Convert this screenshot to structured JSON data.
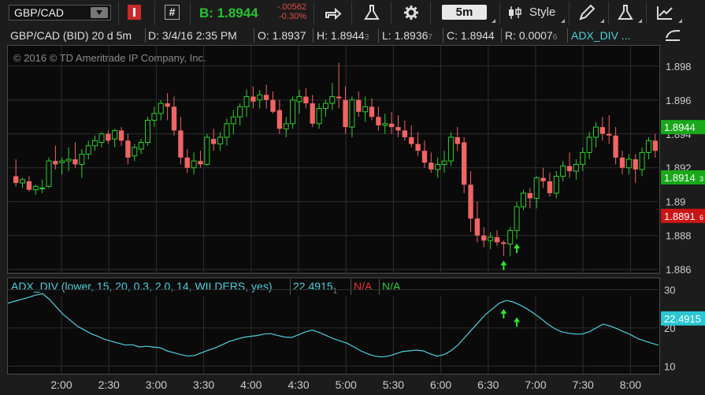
{
  "toolbar": {
    "symbol": "GBP/CAD",
    "bid_label": "B: 1.8944",
    "change_abs": "-.00562",
    "change_pct": "-0.30%",
    "timeframe": "5m",
    "style_label": "Style"
  },
  "infobar": {
    "instrument": "GBP/CAD (BID) 20 d 5m",
    "date": "D: 3/4/16 2:35 PM",
    "open": "O: 1.8937",
    "high": "H: 1.8944",
    "high_sub": "3",
    "low": "L: 1.8936",
    "low_sub": "7",
    "close": "C: 1.8944",
    "range": "R: 0.0007",
    "range_sub": "6",
    "study": "ADX_DIV ..."
  },
  "copyright": "© 2016 © TD Ameritrade IP Company, Inc.",
  "price_axis": {
    "ticks": [
      "1.898",
      "1.896",
      "1.894",
      "1.892",
      "1.89",
      "1.888",
      "1.886"
    ],
    "last_price_badge": "1.8944",
    "level_badge_green": "1.8914",
    "level_badge_green_sub": "3",
    "level_badge_red": "1.8891",
    "level_badge_red_sub": "6",
    "colors": {
      "up": "#2ecf2e",
      "down": "#f26464",
      "green_badge": "#19a819",
      "red_badge": "#cc1414"
    }
  },
  "lower_study": {
    "label": "ADX_DIV (lower, 15, 20, 0.3, 2.0, 14, WILDERS, yes)",
    "value": "22.4915",
    "value_sub": "1",
    "na_red": "N/A",
    "na_green": "N/A",
    "ticks": [
      "30",
      "20",
      "10"
    ],
    "badge": "22.4915",
    "line_color": "#4fd0dc"
  },
  "time_axis": [
    "2:00",
    "2:30",
    "3:00",
    "3:30",
    "4:00",
    "4:30",
    "5:00",
    "5:30",
    "6:00",
    "6:30",
    "7:00",
    "7:30",
    "8:00"
  ],
  "chart_data": {
    "type": "candlestick",
    "title": "GBP/CAD (BID) 20 d 5m",
    "ylim": [
      1.8858,
      1.8992
    ],
    "x_labels": [
      "2:00",
      "2:30",
      "3:00",
      "3:30",
      "4:00",
      "4:30",
      "5:00",
      "5:30",
      "6:00",
      "6:30",
      "7:00",
      "7:30",
      "8:00"
    ],
    "candles": [
      {
        "o": 1.8915,
        "h": 1.8925,
        "l": 1.8909,
        "c": 1.8911
      },
      {
        "o": 1.8911,
        "h": 1.8914,
        "l": 1.8908,
        "c": 1.8913
      },
      {
        "o": 1.8912,
        "h": 1.8915,
        "l": 1.8906,
        "c": 1.8907
      },
      {
        "o": 1.8907,
        "h": 1.891,
        "l": 1.8904,
        "c": 1.8909
      },
      {
        "o": 1.8908,
        "h": 1.8913,
        "l": 1.8905,
        "c": 1.8908
      },
      {
        "o": 1.8909,
        "h": 1.8926,
        "l": 1.8908,
        "c": 1.8924
      },
      {
        "o": 1.8924,
        "h": 1.8933,
        "l": 1.8919,
        "c": 1.8922
      },
      {
        "o": 1.8923,
        "h": 1.8926,
        "l": 1.8916,
        "c": 1.8924
      },
      {
        "o": 1.8924,
        "h": 1.8932,
        "l": 1.8918,
        "c": 1.8925
      },
      {
        "o": 1.8925,
        "h": 1.8935,
        "l": 1.892,
        "c": 1.8922
      },
      {
        "o": 1.8922,
        "h": 1.8931,
        "l": 1.8914,
        "c": 1.8928
      },
      {
        "o": 1.8928,
        "h": 1.8936,
        "l": 1.8925,
        "c": 1.8933
      },
      {
        "o": 1.8933,
        "h": 1.8939,
        "l": 1.893,
        "c": 1.8936
      },
      {
        "o": 1.8935,
        "h": 1.8941,
        "l": 1.8932,
        "c": 1.894
      },
      {
        "o": 1.894,
        "h": 1.8942,
        "l": 1.8934,
        "c": 1.8936
      },
      {
        "o": 1.8937,
        "h": 1.8943,
        "l": 1.8932,
        "c": 1.8942
      },
      {
        "o": 1.8942,
        "h": 1.8944,
        "l": 1.8933,
        "c": 1.8936
      },
      {
        "o": 1.8936,
        "h": 1.894,
        "l": 1.8922,
        "c": 1.8926
      },
      {
        "o": 1.8927,
        "h": 1.8934,
        "l": 1.8924,
        "c": 1.8932
      },
      {
        "o": 1.8931,
        "h": 1.8937,
        "l": 1.8928,
        "c": 1.8935
      },
      {
        "o": 1.8935,
        "h": 1.895,
        "l": 1.8933,
        "c": 1.8948
      },
      {
        "o": 1.8948,
        "h": 1.8956,
        "l": 1.8944,
        "c": 1.8952
      },
      {
        "o": 1.8952,
        "h": 1.896,
        "l": 1.8948,
        "c": 1.8958
      },
      {
        "o": 1.8958,
        "h": 1.8964,
        "l": 1.8948,
        "c": 1.8956
      },
      {
        "o": 1.8956,
        "h": 1.8962,
        "l": 1.8939,
        "c": 1.8942
      },
      {
        "o": 1.8942,
        "h": 1.895,
        "l": 1.8922,
        "c": 1.8926
      },
      {
        "o": 1.8926,
        "h": 1.8931,
        "l": 1.8917,
        "c": 1.892
      },
      {
        "o": 1.892,
        "h": 1.8929,
        "l": 1.8916,
        "c": 1.8924
      },
      {
        "o": 1.8924,
        "h": 1.893,
        "l": 1.892,
        "c": 1.8922
      },
      {
        "o": 1.8922,
        "h": 1.894,
        "l": 1.8921,
        "c": 1.8938
      },
      {
        "o": 1.8937,
        "h": 1.8943,
        "l": 1.893,
        "c": 1.8934
      },
      {
        "o": 1.8934,
        "h": 1.8941,
        "l": 1.893,
        "c": 1.8938
      },
      {
        "o": 1.8938,
        "h": 1.8949,
        "l": 1.8933,
        "c": 1.8946
      },
      {
        "o": 1.8946,
        "h": 1.8954,
        "l": 1.894,
        "c": 1.895
      },
      {
        "o": 1.895,
        "h": 1.8958,
        "l": 1.8945,
        "c": 1.8956
      },
      {
        "o": 1.8956,
        "h": 1.8966,
        "l": 1.895,
        "c": 1.8962
      },
      {
        "o": 1.8962,
        "h": 1.8968,
        "l": 1.8955,
        "c": 1.8959
      },
      {
        "o": 1.896,
        "h": 1.8966,
        "l": 1.8955,
        "c": 1.8963
      },
      {
        "o": 1.8963,
        "h": 1.8969,
        "l": 1.8955,
        "c": 1.896
      },
      {
        "o": 1.896,
        "h": 1.8965,
        "l": 1.8952,
        "c": 1.8953
      },
      {
        "o": 1.8954,
        "h": 1.896,
        "l": 1.894,
        "c": 1.8943
      },
      {
        "o": 1.8943,
        "h": 1.895,
        "l": 1.8938,
        "c": 1.8946
      },
      {
        "o": 1.8946,
        "h": 1.8962,
        "l": 1.8943,
        "c": 1.896
      },
      {
        "o": 1.8959,
        "h": 1.8966,
        "l": 1.8952,
        "c": 1.8962
      },
      {
        "o": 1.8962,
        "h": 1.8967,
        "l": 1.8955,
        "c": 1.8958
      },
      {
        "o": 1.8958,
        "h": 1.8963,
        "l": 1.8944,
        "c": 1.8946
      },
      {
        "o": 1.8946,
        "h": 1.8958,
        "l": 1.8943,
        "c": 1.8955
      },
      {
        "o": 1.8955,
        "h": 1.896,
        "l": 1.895,
        "c": 1.8958
      },
      {
        "o": 1.8958,
        "h": 1.897,
        "l": 1.8954,
        "c": 1.8962
      },
      {
        "o": 1.8962,
        "h": 1.8982,
        "l": 1.8955,
        "c": 1.8961
      },
      {
        "o": 1.896,
        "h": 1.8968,
        "l": 1.894,
        "c": 1.8944
      },
      {
        "o": 1.8944,
        "h": 1.8962,
        "l": 1.8938,
        "c": 1.896
      },
      {
        "o": 1.896,
        "h": 1.8965,
        "l": 1.895,
        "c": 1.8953
      },
      {
        "o": 1.8953,
        "h": 1.8962,
        "l": 1.8947,
        "c": 1.8956
      },
      {
        "o": 1.8956,
        "h": 1.8961,
        "l": 1.8948,
        "c": 1.895
      },
      {
        "o": 1.895,
        "h": 1.8956,
        "l": 1.8942,
        "c": 1.8945
      },
      {
        "o": 1.8945,
        "h": 1.8952,
        "l": 1.894,
        "c": 1.8946
      },
      {
        "o": 1.8946,
        "h": 1.8953,
        "l": 1.894,
        "c": 1.8944
      },
      {
        "o": 1.8944,
        "h": 1.8951,
        "l": 1.8938,
        "c": 1.8942
      },
      {
        "o": 1.8942,
        "h": 1.8948,
        "l": 1.8936,
        "c": 1.8938
      },
      {
        "o": 1.8938,
        "h": 1.8945,
        "l": 1.8932,
        "c": 1.8934
      },
      {
        "o": 1.8934,
        "h": 1.8941,
        "l": 1.8927,
        "c": 1.893
      },
      {
        "o": 1.893,
        "h": 1.8936,
        "l": 1.892,
        "c": 1.8923
      },
      {
        "o": 1.8923,
        "h": 1.8929,
        "l": 1.8917,
        "c": 1.8919
      },
      {
        "o": 1.8919,
        "h": 1.8926,
        "l": 1.8914,
        "c": 1.8922
      },
      {
        "o": 1.8922,
        "h": 1.893,
        "l": 1.8917,
        "c": 1.8924
      },
      {
        "o": 1.8924,
        "h": 1.8941,
        "l": 1.8921,
        "c": 1.8938
      },
      {
        "o": 1.8938,
        "h": 1.8944,
        "l": 1.893,
        "c": 1.8934
      },
      {
        "o": 1.8935,
        "h": 1.8938,
        "l": 1.8905,
        "c": 1.891
      },
      {
        "o": 1.891,
        "h": 1.8918,
        "l": 1.8882,
        "c": 1.889
      },
      {
        "o": 1.889,
        "h": 1.89,
        "l": 1.8876,
        "c": 1.888
      },
      {
        "o": 1.888,
        "h": 1.8885,
        "l": 1.8873,
        "c": 1.8877
      },
      {
        "o": 1.8877,
        "h": 1.8882,
        "l": 1.8872,
        "c": 1.8879
      },
      {
        "o": 1.8879,
        "h": 1.8883,
        "l": 1.8874,
        "c": 1.8876
      },
      {
        "o": 1.8876,
        "h": 1.8877,
        "l": 1.8868,
        "c": 1.8875
      },
      {
        "o": 1.8875,
        "h": 1.8885,
        "l": 1.8868,
        "c": 1.8883
      },
      {
        "o": 1.8883,
        "h": 1.89,
        "l": 1.8878,
        "c": 1.8897
      },
      {
        "o": 1.8897,
        "h": 1.8907,
        "l": 1.8895,
        "c": 1.8905
      },
      {
        "o": 1.8905,
        "h": 1.8908,
        "l": 1.8896,
        "c": 1.8902
      },
      {
        "o": 1.8902,
        "h": 1.8915,
        "l": 1.8896,
        "c": 1.8914
      },
      {
        "o": 1.8914,
        "h": 1.892,
        "l": 1.8908,
        "c": 1.8912
      },
      {
        "o": 1.8912,
        "h": 1.8917,
        "l": 1.8903,
        "c": 1.8905
      },
      {
        "o": 1.8905,
        "h": 1.8918,
        "l": 1.8902,
        "c": 1.8915
      },
      {
        "o": 1.8915,
        "h": 1.8924,
        "l": 1.8912,
        "c": 1.8921
      },
      {
        "o": 1.8921,
        "h": 1.8929,
        "l": 1.8914,
        "c": 1.8918
      },
      {
        "o": 1.8918,
        "h": 1.8925,
        "l": 1.8913,
        "c": 1.8922
      },
      {
        "o": 1.8922,
        "h": 1.8932,
        "l": 1.8918,
        "c": 1.8929
      },
      {
        "o": 1.8929,
        "h": 1.8941,
        "l": 1.8925,
        "c": 1.8938
      },
      {
        "o": 1.8938,
        "h": 1.8947,
        "l": 1.8932,
        "c": 1.8944
      },
      {
        "o": 1.8944,
        "h": 1.895,
        "l": 1.8936,
        "c": 1.894
      },
      {
        "o": 1.894,
        "h": 1.8951,
        "l": 1.8934,
        "c": 1.8939
      },
      {
        "o": 1.8939,
        "h": 1.8944,
        "l": 1.8922,
        "c": 1.8926
      },
      {
        "o": 1.8926,
        "h": 1.893,
        "l": 1.8916,
        "c": 1.892
      },
      {
        "o": 1.892,
        "h": 1.8928,
        "l": 1.8916,
        "c": 1.8925
      },
      {
        "o": 1.8925,
        "h": 1.8928,
        "l": 1.8911,
        "c": 1.8919
      },
      {
        "o": 1.8919,
        "h": 1.8932,
        "l": 1.8915,
        "c": 1.8929
      },
      {
        "o": 1.8929,
        "h": 1.8938,
        "l": 1.8925,
        "c": 1.8936
      },
      {
        "o": 1.8936,
        "h": 1.894,
        "l": 1.8926,
        "c": 1.893
      }
    ],
    "signal_arrows_at_candle": [
      74,
      76
    ],
    "lower_series": {
      "name": "ADX_DIV",
      "ylim": [
        8,
        33
      ],
      "values": [
        26.5,
        27.0,
        27.5,
        28.0,
        28.6,
        29.0,
        27.5,
        25.5,
        23.5,
        22.0,
        20.5,
        19.5,
        18.5,
        17.8,
        17.0,
        16.5,
        16.0,
        15.5,
        15.6,
        15.0,
        15.2,
        15.0,
        14.8,
        14.0,
        13.5,
        13.0,
        12.6,
        12.8,
        13.5,
        14.2,
        14.8,
        15.6,
        16.5,
        17.0,
        17.5,
        17.8,
        18.0,
        18.4,
        18.5,
        18.0,
        17.6,
        17.5,
        18.2,
        19.0,
        19.4,
        18.8,
        18.0,
        17.2,
        16.6,
        16.0,
        15.0,
        14.0,
        13.2,
        12.6,
        12.4,
        12.6,
        13.2,
        13.8,
        14.0,
        14.2,
        14.0,
        13.2,
        12.6,
        13.0,
        14.0,
        15.5,
        17.5,
        19.5,
        21.5,
        23.5,
        25.0,
        26.5,
        27.2,
        26.8,
        26.0,
        25.0,
        23.8,
        22.5,
        21.0,
        19.8,
        19.0,
        18.6,
        18.4,
        18.4,
        19.0,
        20.0,
        21.0,
        20.5,
        19.8,
        19.0,
        18.2,
        17.2,
        16.6,
        16.0,
        15.5
      ]
    }
  }
}
